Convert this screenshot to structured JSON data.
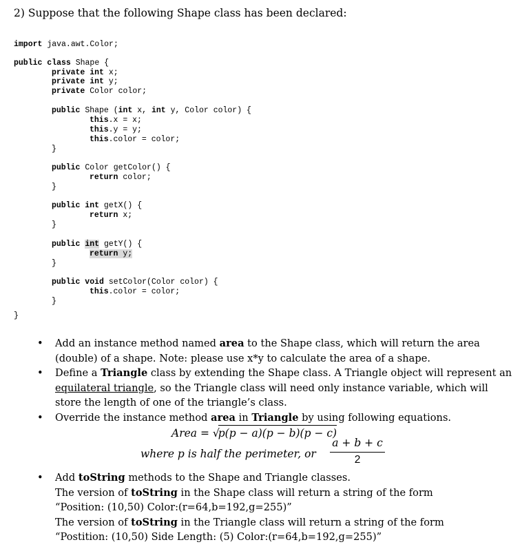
{
  "question": {
    "number": "2)",
    "heading": "Suppose that the following Shape class has been declared:"
  },
  "code": {
    "lines": [
      {
        "kw": "import",
        "rest": " java.awt.Color;"
      },
      {
        "kw": "public class",
        "rest": " Shape {"
      },
      {
        "kw": "private int",
        "rest": " x;"
      },
      {
        "kw": "private int",
        "rest": " y;"
      },
      {
        "kw": "private",
        "rest": " Color color;"
      },
      {
        "kw": "public",
        "rest": " Shape (",
        "kw2": "int",
        "rest2": " x, ",
        "kw3": "int",
        "rest3": " y, Color color) {"
      },
      {
        "kw": "this",
        "rest": ".x = x;"
      },
      {
        "kw": "this",
        "rest": ".y = y;"
      },
      {
        "kw": "this",
        "rest": ".color = color;"
      },
      {
        "kw": "",
        "rest": "}"
      },
      {
        "kw": "public",
        "rest": " Color getColor() {"
      },
      {
        "kw": "return",
        "rest": " color;"
      },
      {
        "kw": "",
        "rest": "}"
      },
      {
        "kw": "public int",
        "rest": " getX() {"
      },
      {
        "kw": "return",
        "rest": " x;"
      },
      {
        "kw": "",
        "rest": "}"
      },
      {
        "kw": "public",
        "rest": " ",
        "kw2": "int",
        "rest2": " getY() {"
      },
      {
        "kw": "return",
        "rest": " y;"
      },
      {
        "kw": "",
        "rest": "}"
      },
      {
        "kw": "public void",
        "rest": " setColor(Color color) {"
      },
      {
        "kw": "this",
        "rest": ".color = color;"
      },
      {
        "kw": "",
        "rest": "}"
      },
      {
        "kw": "",
        "rest": "}"
      }
    ]
  },
  "bullets": {
    "b1": {
      "pre": "Add an instance method named ",
      "bold": "area",
      "post": " to the Shape class, which will return the area (double) of a shape. Note: please use x*y to calculate the area of a shape."
    },
    "b2": {
      "pre": "Define a ",
      "bold": "Triangle",
      "mid": " class by extending the Shape class. A Triangle object will represent an ",
      "underline": "equilateral triangle",
      "post": ", so the Triangle class will need only instance variable, which will store the length of one of the triangle’s class."
    },
    "b3": {
      "pre": "Override the instance method ",
      "bold1": "area",
      "mid": " in ",
      "bold2": "Triangle",
      "post": " by using following equations."
    },
    "formula": {
      "area_label": "Area = ",
      "sqrt_symbol": "√",
      "radicand": "p(p − a)(p − b)(p − c)",
      "where_text": "where p is half the perimeter, or",
      "numerator": "a + b + c",
      "denominator": "2"
    },
    "b4": {
      "pre": "Add ",
      "bold": "toString",
      "post": " methods to the Shape and Triangle classes.",
      "line2_pre": "The version of ",
      "line2_bold": "toString",
      "line2_post": " in the Shape class will return a string of the form",
      "line3": "“Position: (10,50)  Color:(r=64,b=192,g=255)”",
      "line4_pre": "The version of ",
      "line4_bold": "toString",
      "line4_post": " in the Triangle class will return a string of the form",
      "line5": "“Postition: (10,50)  Side Length: (5) Color:(r=64,b=192,g=255)”"
    },
    "bullet_symbol": "•"
  }
}
